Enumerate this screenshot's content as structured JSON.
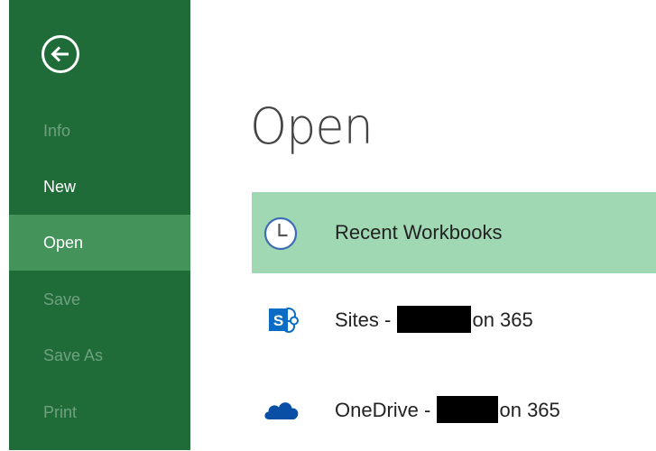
{
  "sidebar": {
    "background_color": "#1f6c38",
    "selected_color": "#43935b",
    "disabled_text_color": "#6fa17f",
    "back_icon": "back-arrow-icon",
    "items": [
      {
        "label": "Info",
        "state": "disabled"
      },
      {
        "label": "New",
        "state": "enabled"
      },
      {
        "label": "Open",
        "state": "selected"
      },
      {
        "label": "Save",
        "state": "disabled"
      },
      {
        "label": "Save As",
        "state": "disabled"
      },
      {
        "label": "Print",
        "state": "disabled"
      }
    ]
  },
  "main": {
    "title": "Open",
    "selected_color": "#9fd8b2",
    "locations": [
      {
        "icon": "clock-icon",
        "label": "Recent Workbooks",
        "selected": true
      },
      {
        "icon": "sharepoint-icon",
        "icon_letter": "S",
        "label_prefix": "Sites - ",
        "label_suffix": "on 365",
        "redacted": true
      },
      {
        "icon": "onedrive-cloud-icon",
        "label_prefix": "OneDrive - ",
        "label_suffix": "on 365",
        "redacted": true
      }
    ]
  }
}
